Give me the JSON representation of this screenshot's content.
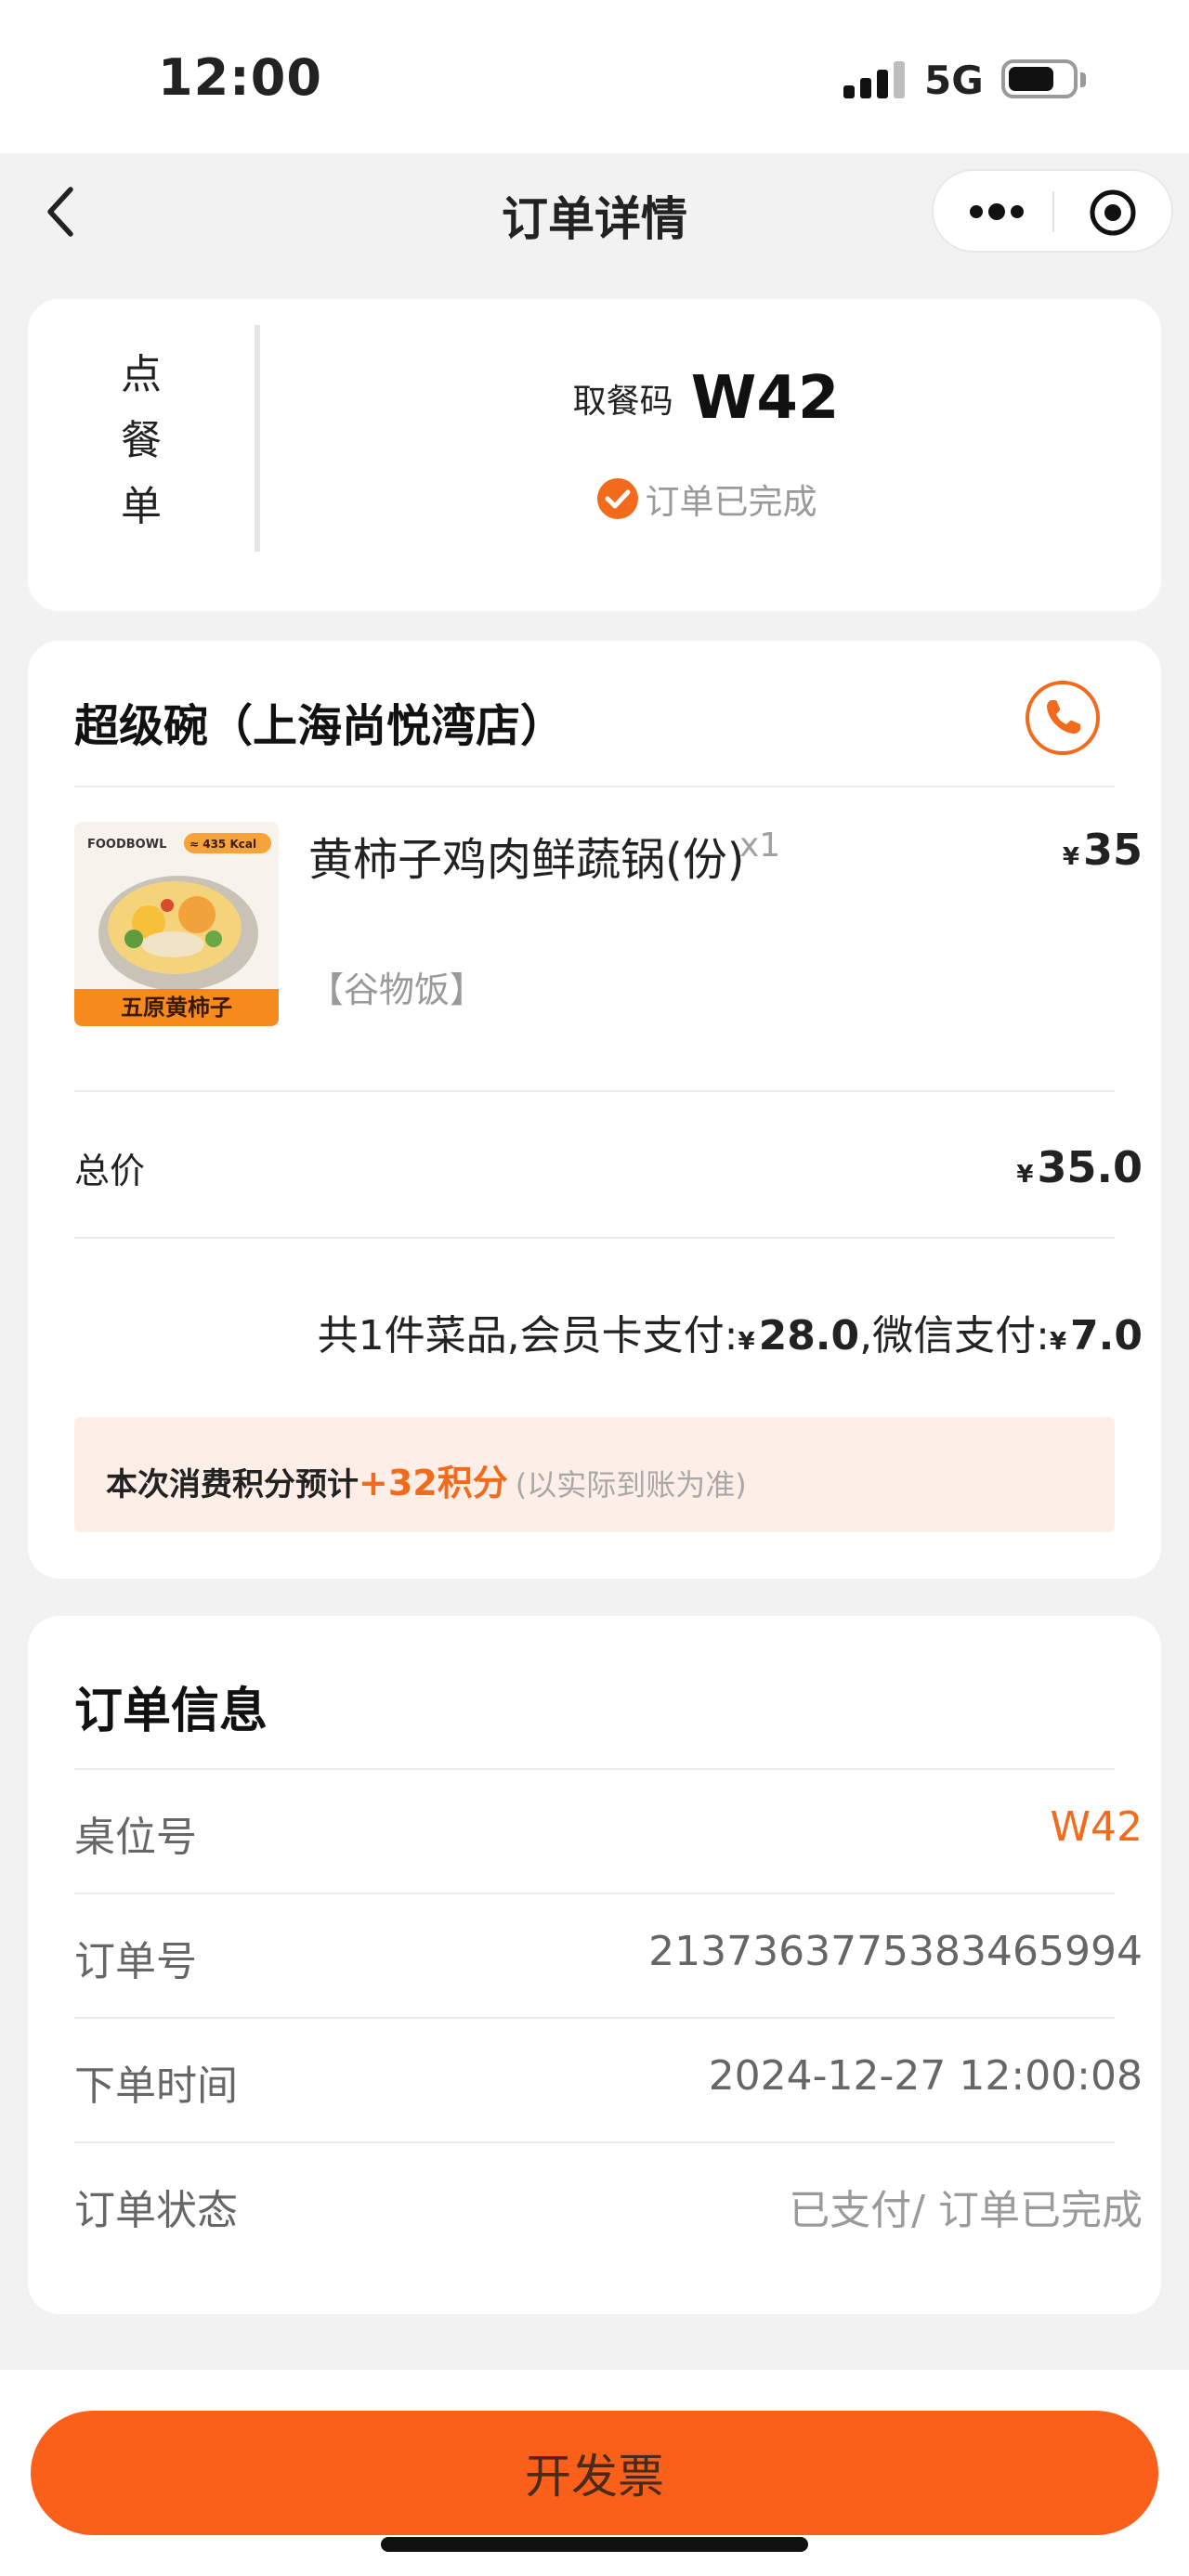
{
  "status_bar": {
    "time": "12:00",
    "network": "5G"
  },
  "nav": {
    "title": "订单详情"
  },
  "order_card": {
    "vertical_label": [
      "点",
      "餐",
      "单"
    ],
    "pickup_label": "取餐码",
    "pickup_code": "W42",
    "status_text": "订单已完成"
  },
  "store": {
    "name": "超级碗（上海尚悦湾店）",
    "items": [
      {
        "name": "黄柿子鸡肉鲜蔬锅(份)",
        "spec": "【谷物饭】",
        "qty": "x1",
        "currency": "¥",
        "price": "35",
        "image_text": {
          "brand": "FOODBOWL",
          "kcal": "≈ 435 Kcal",
          "caption": "五原黄柿子"
        }
      }
    ],
    "total_label": "总价",
    "total_currency": "¥",
    "total_value": "35.0",
    "payment": {
      "prefix": "共1件菜品,会员卡支付:",
      "card_currency": "¥",
      "card_amount": "28.0",
      "middle": ",微信支付:",
      "wechat_currency": "¥",
      "wechat_amount": "7.0"
    },
    "points": {
      "prefix": "本次消费积分预计",
      "amount": "+32积分",
      "note": "(以实际到账为准)"
    }
  },
  "order_info": {
    "title": "订单信息",
    "rows": [
      {
        "label": "桌位号",
        "value": "W42"
      },
      {
        "label": "订单号",
        "value": "2137363775383465994"
      },
      {
        "label": "下单时间",
        "value": "2024-12-27 12:00:08"
      },
      {
        "label": "订单状态",
        "value": "已支付/ 订单已完成"
      }
    ]
  },
  "footer": {
    "invoice_button": "开发票"
  },
  "colors": {
    "accent": "#f26a1b",
    "button": "#fb601b",
    "points_bg": "#fdeee7"
  }
}
